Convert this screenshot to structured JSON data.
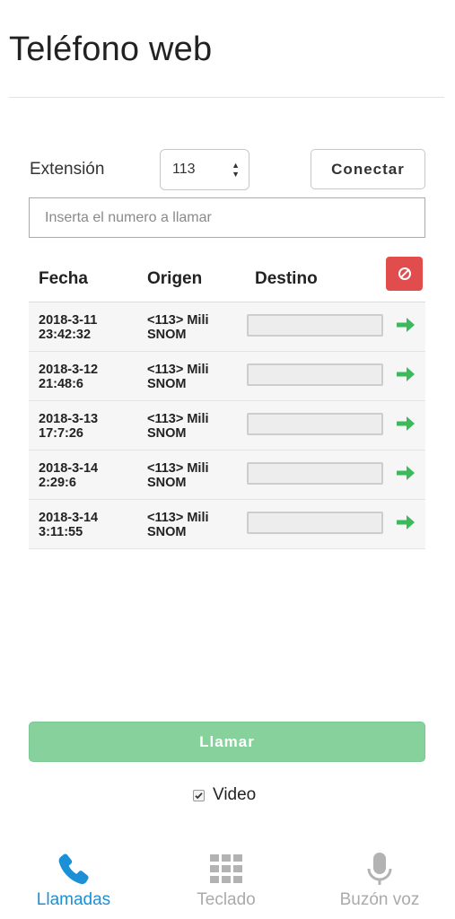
{
  "page": {
    "title": "Teléfono web"
  },
  "extension": {
    "label": "Extensión",
    "selected": "113"
  },
  "connect_label": "Conectar",
  "number_input": {
    "placeholder": "Inserta el numero a llamar",
    "value": ""
  },
  "table": {
    "headers": {
      "fecha": "Fecha",
      "origen": "Origen",
      "destino": "Destino"
    },
    "rows": [
      {
        "date": "2018-3-11",
        "time": "23:42:32",
        "origin_line1": "<113> Mili",
        "origin_line2": "SNOM"
      },
      {
        "date": "2018-3-12",
        "time": "21:48:6",
        "origin_line1": "<113> Mili",
        "origin_line2": "SNOM"
      },
      {
        "date": "2018-3-13",
        "time": "17:7:26",
        "origin_line1": "<113> Mili",
        "origin_line2": "SNOM"
      },
      {
        "date": "2018-3-14",
        "time": "2:29:6",
        "origin_line1": "<113> Mili",
        "origin_line2": "SNOM"
      },
      {
        "date": "2018-3-14",
        "time": "3:11:55",
        "origin_line1": "<113> Mili",
        "origin_line2": "SNOM"
      }
    ]
  },
  "call_label": "Llamar",
  "video": {
    "label": "Video",
    "checked": true
  },
  "tabs": {
    "calls": "Llamadas",
    "keypad": "Teclado",
    "voicemail": "Buzón voz"
  },
  "colors": {
    "accent_blue": "#1b90d6",
    "call_green": "#86d19c",
    "arrow_green": "#3cb95a",
    "clear_red": "#e14d4d",
    "inactive_gray": "#aaaaaa"
  },
  "icons": {
    "clear": "block-icon",
    "row_action": "arrow-right-icon",
    "calls_tab": "phone-icon",
    "keypad_tab": "keypad-icon",
    "voicemail_tab": "microphone-icon"
  }
}
